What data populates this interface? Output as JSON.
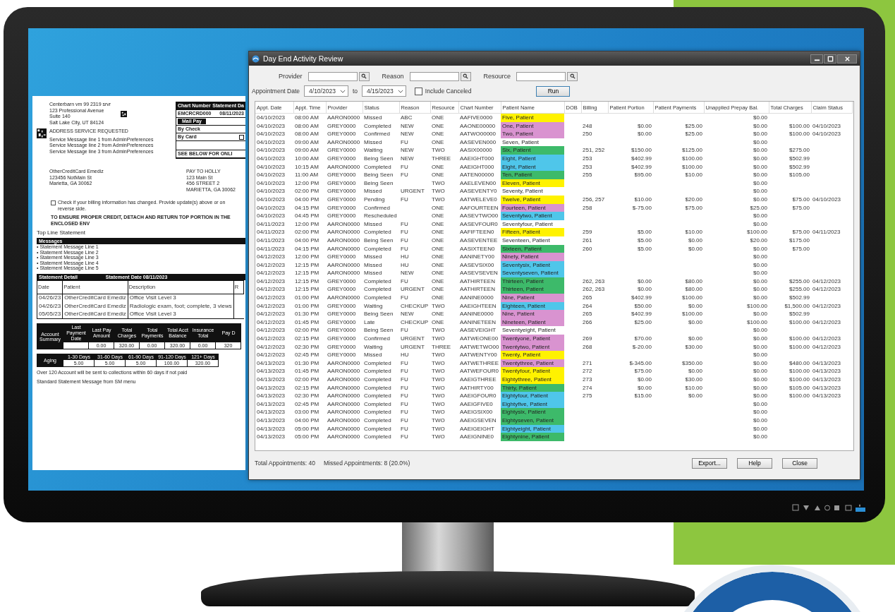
{
  "statement": {
    "sender": [
      "Centerbarn vm 99 2319 srvr",
      "123 Professional Avenue",
      "Suite 140",
      "Salt Lake City, UT 84124"
    ],
    "address_notice": "ADDRESS SERVICE REQUESTED",
    "service_messages": [
      "Service Message line 1 from AdminPreferences",
      "Service Message line 2 from AdminPreferences",
      "Service Message line 3 from AdminPreferences"
    ],
    "pay_box": {
      "chart_label": "Chart Number",
      "date_label": "Statement Da",
      "chart": "EMCRCRD000",
      "date": "08/11/2023",
      "mail_pay": "Mail Pay",
      "by_check": "By Check",
      "by_card": "By Card",
      "card_box": {
        "checked": false
      },
      "see_below": "SEE BELOW FOR ONLI"
    },
    "recipient": [
      "OtherCreditCard Emediz",
      "123456 NotMain St",
      "Marietta, GA 30062"
    ],
    "pay_to": [
      "PAY TO HOLLY",
      "123 Main St",
      "456 STREET 2",
      "MARIETTA, GA 30062"
    ],
    "check_box": {
      "checked": false
    },
    "check_note": "Check if your billing information has changed. Provide update(s) above or on reverse side.",
    "detach_note": "TO ENSURE PROPER CREDIT, DETACH AND RETURN TOP PORTION IN THE ENCLOSED ENV",
    "top_line": "Top Line Statement",
    "messages_title": "Messages",
    "messages": [
      "• Statement Message Line 1",
      "• Statement Message Line 2",
      "• Statement Message Line 3",
      "• Statement Message Line 4",
      "• Statement Message Line 5"
    ],
    "detail": {
      "title": "Statement Detail",
      "date": "Statement Date 08/11/2023",
      "columns": [
        "Date",
        "Patient",
        "Description",
        "R"
      ],
      "rows": [
        [
          "04/26/23",
          "OtherCreditCard Emediz",
          "Office Visit Level 3"
        ],
        [
          "04/26/23",
          "OtherCreditCard Emediz",
          "Radiologic exam, foot; complete, 3 views"
        ],
        [
          "05/05/23",
          "OtherCreditCard Emediz",
          "Office Visit Level 3"
        ]
      ]
    },
    "account": {
      "title": "Account Summary",
      "columns": [
        {
          "label": "Last Payment Date"
        },
        {
          "label": "Last Pay Amount",
          "value": "0.00"
        },
        {
          "label": "Total Charges",
          "value": "320.00"
        },
        {
          "label": "Total Payments",
          "value": "0.00"
        },
        {
          "label": "Total Acct Balance",
          "value": "320.00"
        },
        {
          "label": "Insurance Total",
          "value": "0.00"
        },
        {
          "label": "Pay D",
          "value": "320"
        }
      ]
    },
    "aging": {
      "title": "Aging",
      "columns": [
        "1-30 Days",
        "31-60 Days",
        "61-90 Days",
        "91-120 Days",
        "121+ Days"
      ],
      "values": [
        "5.00",
        "5.00",
        "5.00",
        "100.00",
        "320.00"
      ]
    },
    "notes": [
      "Over 120 Account will be sent to collections within 60 days if not paid",
      "Standard Statement Message from SM menu"
    ]
  },
  "dialog": {
    "title": "Day End Activity Review",
    "filters": [
      {
        "label": "Provider"
      },
      {
        "label": "Reason"
      },
      {
        "label": "Resource"
      }
    ],
    "date_label": "Appointment Date",
    "date_from": "4/10/2023",
    "to_label": "to",
    "date_to": "4/15/2023",
    "include_canceled": {
      "label": "Include Canceled",
      "checked": false
    },
    "run_button": "Run",
    "table": {
      "columns": [
        "Appt. Date",
        "Appt. Time",
        "Provider",
        "Status",
        "Reason",
        "Resource",
        "Chart Number",
        "Patient Name",
        "DOB",
        "Billing",
        "Patient Portion",
        "Patient Payments",
        "Unapplied Prepay Bal.",
        "Total Charges",
        "Claim Status"
      ],
      "rows": [
        {
          "cells": [
            "04/10/2023",
            "08:00 AM",
            "AARON0000",
            "Missed",
            "ABC",
            "ONE",
            "AAFIVE0000",
            "Five, Patient",
            null,
            null,
            null,
            null,
            "$0.00",
            null,
            null
          ],
          "color": "#fff200"
        },
        {
          "cells": [
            "04/10/2023",
            "08:00 AM",
            "GREY0000",
            "Completed",
            "NEW",
            "ONE",
            "AAONE00000",
            "One, Patient",
            null,
            "248",
            "$0.00",
            "$25.00",
            "$0.00",
            "$100.00",
            "04/10/2023"
          ],
          "color": "#d993d0"
        },
        {
          "cells": [
            "04/10/2023",
            "08:00 AM",
            "GREY0000",
            "Confirmed",
            "NEW",
            "ONE",
            "AATWO00000",
            "Two, Patient",
            null,
            "250",
            "$0.00",
            "$25.00",
            "$0.00",
            "$100.00",
            "04/10/2023"
          ],
          "color": "#d993d0"
        },
        {
          "cells": [
            "04/10/2023",
            "09:00 AM",
            "AARON0000",
            "Missed",
            "FU",
            "ONE",
            "AASEVEN000",
            "Seven, Patient",
            null,
            null,
            null,
            null,
            "$0.00",
            null,
            null
          ]
        },
        {
          "cells": [
            "04/10/2023",
            "09:00 AM",
            "GREY0000",
            "Waiting",
            "NEW",
            "TWO",
            "AASIX00000",
            "Six, Patient",
            null,
            "251, 252",
            "$150.00",
            "$125.00",
            "$0.00",
            "$275.00",
            null
          ],
          "color": "#3dba6a"
        },
        {
          "cells": [
            "04/10/2023",
            "10:00 AM",
            "GREY0000",
            "Being Seen",
            "NEW",
            "THREE",
            "AAEIGHT000",
            "Eight, Patient",
            null,
            "253",
            "$402.99",
            "$100.00",
            "$0.00",
            "$502.99",
            null
          ],
          "color": "#4fc6ea"
        },
        {
          "cells": [
            "04/10/2023",
            "10:15 AM",
            "AARON0000",
            "Completed",
            "FU",
            "ONE",
            "AAEIGHT000",
            "Eight, Patient",
            null,
            "253",
            "$402.99",
            "$100.00",
            "$0.00",
            "$502.99",
            null
          ],
          "color": "#4fc6ea"
        },
        {
          "cells": [
            "04/10/2023",
            "11:00 AM",
            "GREY0000",
            "Being Seen",
            "FU",
            "ONE",
            "AATEN00000",
            "Ten, Patient",
            null,
            "255",
            "$95.00",
            "$10.00",
            "$0.00",
            "$105.00",
            null
          ],
          "color": "#3dba6a"
        },
        {
          "cells": [
            "04/10/2023",
            "12:00 PM",
            "GREY0000",
            "Being Seen",
            null,
            "TWO",
            "AAELEVEN00",
            "Eleven, Patient",
            null,
            null,
            null,
            null,
            "$0.00",
            null,
            null
          ],
          "color": "#fff200"
        },
        {
          "cells": [
            "04/10/2023",
            "02:00 PM",
            "GREY0000",
            "Missed",
            "URGENT",
            "TWO",
            "AASEVENTY0",
            "Seventy, Patient",
            null,
            null,
            null,
            null,
            "$0.00",
            null,
            null
          ]
        },
        {
          "cells": [
            "04/10/2023",
            "04:00 PM",
            "GREY0000",
            "Pending",
            "FU",
            "TWO",
            "AATWELEVE0",
            "Twelve, Patient",
            null,
            "256, 257",
            "$10.00",
            "$20.00",
            "$0.00",
            "$75.00",
            "04/10/2023"
          ],
          "color": "#fff200"
        },
        {
          "cells": [
            "04/10/2023",
            "04:15 PM",
            "GREY0000",
            "Confirmed",
            null,
            "ONE",
            "AAFOURTEEN",
            "Fourteen, Patient",
            null,
            "258",
            "$-75.00",
            "$75.00",
            "$25.00",
            "$75.00",
            null
          ],
          "color": "#d993d0"
        },
        {
          "cells": [
            "04/10/2023",
            "04:45 PM",
            "GREY0000",
            "Rescheduled",
            null,
            "ONE",
            "AASEVTWO00",
            "Seventytwo, Patient",
            null,
            null,
            null,
            null,
            "$0.00",
            null,
            null
          ],
          "color": "#4fc6ea"
        },
        {
          "cells": [
            "04/11/2023",
            "12:00 PM",
            "AARON0000",
            "Missed",
            "FU",
            "ONE",
            "AASEVFOUR0",
            "Seventyfour, Patient",
            null,
            null,
            null,
            null,
            "$0.00",
            null,
            null
          ]
        },
        {
          "cells": [
            "04/11/2023",
            "02:00 PM",
            "AARON0000",
            "Completed",
            "FU",
            "ONE",
            "AAFIFTEEN0",
            "Fifteen, Patient",
            null,
            "259",
            "$5.00",
            "$10.00",
            "$100.00",
            "$75.00",
            "04/11/2023"
          ],
          "color": "#fff200"
        },
        {
          "cells": [
            "04/11/2023",
            "04:00 PM",
            "AARON0000",
            "Being Seen",
            "FU",
            "ONE",
            "AASEVENTEE",
            "Seventeen, Patient",
            null,
            "261",
            "$5.00",
            "$0.00",
            "$20.00",
            "$175.00",
            null
          ]
        },
        {
          "cells": [
            "04/11/2023",
            "04:15 PM",
            "AARON0000",
            "Completed",
            "FU",
            "ONE",
            "AASIXTEEN0",
            "Sixteen, Patient",
            null,
            "260",
            "$5.00",
            "$0.00",
            "$0.00",
            "$75.00",
            null
          ],
          "color": "#3dba6a"
        },
        {
          "cells": [
            "04/12/2023",
            "12:00 PM",
            "GREY0000",
            "Missed",
            "HU",
            "ONE",
            "AANINETY00",
            "Ninety, Patient",
            null,
            null,
            null,
            null,
            "$0.00",
            null,
            null
          ],
          "color": "#d993d0"
        },
        {
          "cells": [
            "04/12/2023",
            "12:15 PM",
            "AARON0000",
            "Missed",
            "HU",
            "ONE",
            "AASEVSIX00",
            "Seventysix, Patient",
            null,
            null,
            null,
            null,
            "$0.00",
            null,
            null
          ],
          "color": "#4fc6ea"
        },
        {
          "cells": [
            "04/12/2023",
            "12:15 PM",
            "AARON0000",
            "Missed",
            "NEW",
            "ONE",
            "AASEVSEVEN",
            "Seventyseven, Patient",
            null,
            null,
            null,
            null,
            "$0.00",
            null,
            null
          ],
          "color": "#4fc6ea"
        },
        {
          "cells": [
            "04/12/2023",
            "12:15 PM",
            "GREY0000",
            "Completed",
            "FU",
            "ONE",
            "AATHIRTEEN",
            "Thirteen, Patient",
            null,
            "262, 263",
            "$0.00",
            "$80.00",
            "$0.00",
            "$255.00",
            "04/12/2023"
          ],
          "color": "#3dba6a"
        },
        {
          "cells": [
            "04/12/2023",
            "12:15 PM",
            "GREY0000",
            "Completed",
            "URGENT",
            "ONE",
            "AATHIRTEEN",
            "Thirteen, Patient",
            null,
            "262, 263",
            "$0.00",
            "$80.00",
            "$0.00",
            "$255.00",
            "04/12/2023"
          ],
          "color": "#3dba6a"
        },
        {
          "cells": [
            "04/12/2023",
            "01:00 PM",
            "AARON0000",
            "Completed",
            "FU",
            "ONE",
            "AANINE0000",
            "Nine, Patient",
            null,
            "265",
            "$402.99",
            "$100.00",
            "$0.00",
            "$502.99",
            null
          ],
          "color": "#d993d0"
        },
        {
          "cells": [
            "04/12/2023",
            "01:00 PM",
            "GREY0000",
            "Waiting",
            "CHECKUP",
            "TWO",
            "AAEIGHTEEN",
            "Eighteen, Patient",
            null,
            "264",
            "$50.00",
            "$0.00",
            "$100.00",
            "$1,500.00",
            "04/12/2023"
          ],
          "color": "#4fc6ea"
        },
        {
          "cells": [
            "04/12/2023",
            "01:30 PM",
            "GREY0000",
            "Being Seen",
            "NEW",
            "ONE",
            "AANINE0000",
            "Nine, Patient",
            null,
            "265",
            "$402.99",
            "$100.00",
            "$0.00",
            "$502.99",
            null
          ],
          "color": "#d993d0"
        },
        {
          "cells": [
            "04/12/2023",
            "01:45 PM",
            "GREY0000",
            "Late",
            "CHECKUP",
            "ONE",
            "AANINETEEN",
            "Nineteen, Patient",
            null,
            "266",
            "$25.00",
            "$0.00",
            "$100.00",
            "$100.00",
            "04/12/2023"
          ],
          "color": "#d993d0"
        },
        {
          "cells": [
            "04/12/2023",
            "02:00 PM",
            "GREY0000",
            "Being Seen",
            "FU",
            "TWO",
            "AASEVEIGHT",
            "Seventyeight, Patient",
            null,
            null,
            null,
            null,
            "$0.00",
            null,
            null
          ]
        },
        {
          "cells": [
            "04/12/2023",
            "02:15 PM",
            "GREY0000",
            "Confirmed",
            "URGENT",
            "TWO",
            "AATWEONE00",
            "Twentyone, Patient",
            null,
            "269",
            "$70.00",
            "$0.00",
            "$0.00",
            "$100.00",
            "04/12/2023"
          ],
          "color": "#d993d0"
        },
        {
          "cells": [
            "04/12/2023",
            "02:30 PM",
            "GREY0000",
            "Waiting",
            "URGENT",
            "THREE",
            "AATWETWO00",
            "Twentytwo, Patient",
            null,
            "268",
            "$-20.00",
            "$30.00",
            "$0.00",
            "$100.00",
            "04/12/2023"
          ],
          "color": "#d993d0"
        },
        {
          "cells": [
            "04/12/2023",
            "02:45 PM",
            "GREY0000",
            "Missed",
            "HU",
            "TWO",
            "AATWENTY00",
            "Twenty, Patient",
            null,
            null,
            null,
            null,
            "$0.00",
            null,
            null
          ],
          "color": "#fff200"
        },
        {
          "cells": [
            "04/13/2023",
            "01:30 PM",
            "AARON0000",
            "Completed",
            "FU",
            "TWO",
            "AATWETHREE",
            "Twentythree, Patient",
            null,
            "271",
            "$-345.00",
            "$350.00",
            "$0.00",
            "$480.00",
            "04/13/2023"
          ],
          "color": "#d993d0"
        },
        {
          "cells": [
            "04/13/2023",
            "01:45 PM",
            "AARON0000",
            "Completed",
            "FU",
            "TWO",
            "AATWEFOUR0",
            "Twentyfour, Patient",
            null,
            "272",
            "$75.00",
            "$0.00",
            "$0.00",
            "$100.00",
            "04/13/2023"
          ],
          "color": "#fff200"
        },
        {
          "cells": [
            "04/13/2023",
            "02:00 PM",
            "AARON0000",
            "Completed",
            "FU",
            "TWO",
            "AAEIGTHREE",
            "Eightythree, Patient",
            null,
            "273",
            "$0.00",
            "$30.00",
            "$0.00",
            "$100.00",
            "04/13/2023"
          ],
          "color": "#fff200"
        },
        {
          "cells": [
            "04/13/2023",
            "02:15 PM",
            "AARON0000",
            "Completed",
            "FU",
            "TWO",
            "AATHIRTY00",
            "Thirty, Patient",
            null,
            "274",
            "$0.00",
            "$10.00",
            "$0.00",
            "$105.00",
            "04/13/2023"
          ],
          "color": "#3dba6a"
        },
        {
          "cells": [
            "04/13/2023",
            "02:30 PM",
            "AARON0000",
            "Completed",
            "FU",
            "TWO",
            "AAEIGFOUR0",
            "Eightyfour, Patient",
            null,
            "275",
            "$15.00",
            "$0.00",
            "$0.00",
            "$100.00",
            "04/13/2023"
          ],
          "color": "#4fc6ea"
        },
        {
          "cells": [
            "04/13/2023",
            "02:45 PM",
            "AARON0000",
            "Completed",
            "FU",
            "TWO",
            "AAEIGFIVE0",
            "Eightyfive, Patient",
            null,
            null,
            null,
            null,
            "$0.00",
            null,
            null
          ],
          "color": "#4fc6ea"
        },
        {
          "cells": [
            "04/13/2023",
            "03:00 PM",
            "AARON0000",
            "Completed",
            "FU",
            "TWO",
            "AAEIGSIX00",
            "Eightysix, Patient",
            null,
            null,
            null,
            null,
            "$0.00",
            null,
            null
          ],
          "color": "#3dba6a"
        },
        {
          "cells": [
            "04/13/2023",
            "04:00 PM",
            "AARON0000",
            "Completed",
            "FU",
            "TWO",
            "AAEIGSEVEN",
            "Eightyseven, Patient",
            null,
            null,
            null,
            null,
            "$0.00",
            null,
            null
          ],
          "color": "#3dba6a"
        },
        {
          "cells": [
            "04/13/2023",
            "05:00 PM",
            "AARON0000",
            "Completed",
            "FU",
            "TWO",
            "AAEIGEIGHT",
            "Eightyeight, Patient",
            null,
            null,
            null,
            null,
            "$0.00",
            null,
            null
          ],
          "color": "#4fc6ea"
        },
        {
          "cells": [
            "04/13/2023",
            "05:00 PM",
            "AARON0000",
            "Completed",
            "FU",
            "TWO",
            "AAEIGNINE0",
            "Eightynine, Patient",
            null,
            null,
            null,
            null,
            "$0.00",
            null,
            null
          ],
          "color": "#3dba6a"
        }
      ]
    },
    "summary": [
      "Total Appointments: 40",
      "Missed Appointments: 8 (20.0%)"
    ],
    "buttons": [
      "Export...",
      "Help",
      "Close"
    ]
  }
}
